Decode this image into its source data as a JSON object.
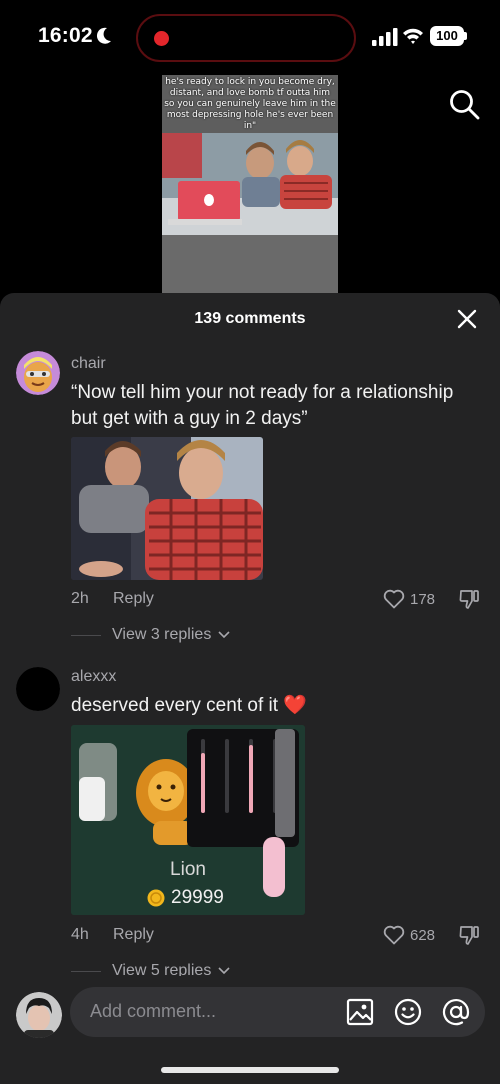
{
  "status_bar": {
    "time": "16:02",
    "battery": "100"
  },
  "video": {
    "overlay_text": "he's ready to lock in you become dry, distant, and love bomb tf outta him so you can genuinely leave him in the most depressing hole he's ever been in\""
  },
  "sheet": {
    "title": "139 comments"
  },
  "comments": [
    {
      "username": "chair",
      "text": "“Now tell him your not ready for a relationship but get with a guy in 2 days”",
      "age": "2h",
      "reply_label": "Reply",
      "likes": "178",
      "view_replies": "View 3 replies"
    },
    {
      "username": "alexxx",
      "text": "deserved every cent of it ❤️",
      "age": "4h",
      "reply_label": "Reply",
      "likes": "628",
      "view_replies": "View 5 replies",
      "gift": {
        "name": "Lion",
        "price": "29999"
      }
    }
  ],
  "composer": {
    "placeholder": "Add comment..."
  },
  "colors": {
    "sheet_bg": "#232324",
    "like_heart": "#a8a8ad",
    "recording_dot": "#e3262b"
  },
  "icons": [
    "moon-icon",
    "signal-icon",
    "wifi-icon",
    "search-icon",
    "close-icon",
    "heart-icon",
    "dislike-icon",
    "chevron-down-icon",
    "image-icon",
    "emoji-icon",
    "mention-icon",
    "coin-icon"
  ]
}
